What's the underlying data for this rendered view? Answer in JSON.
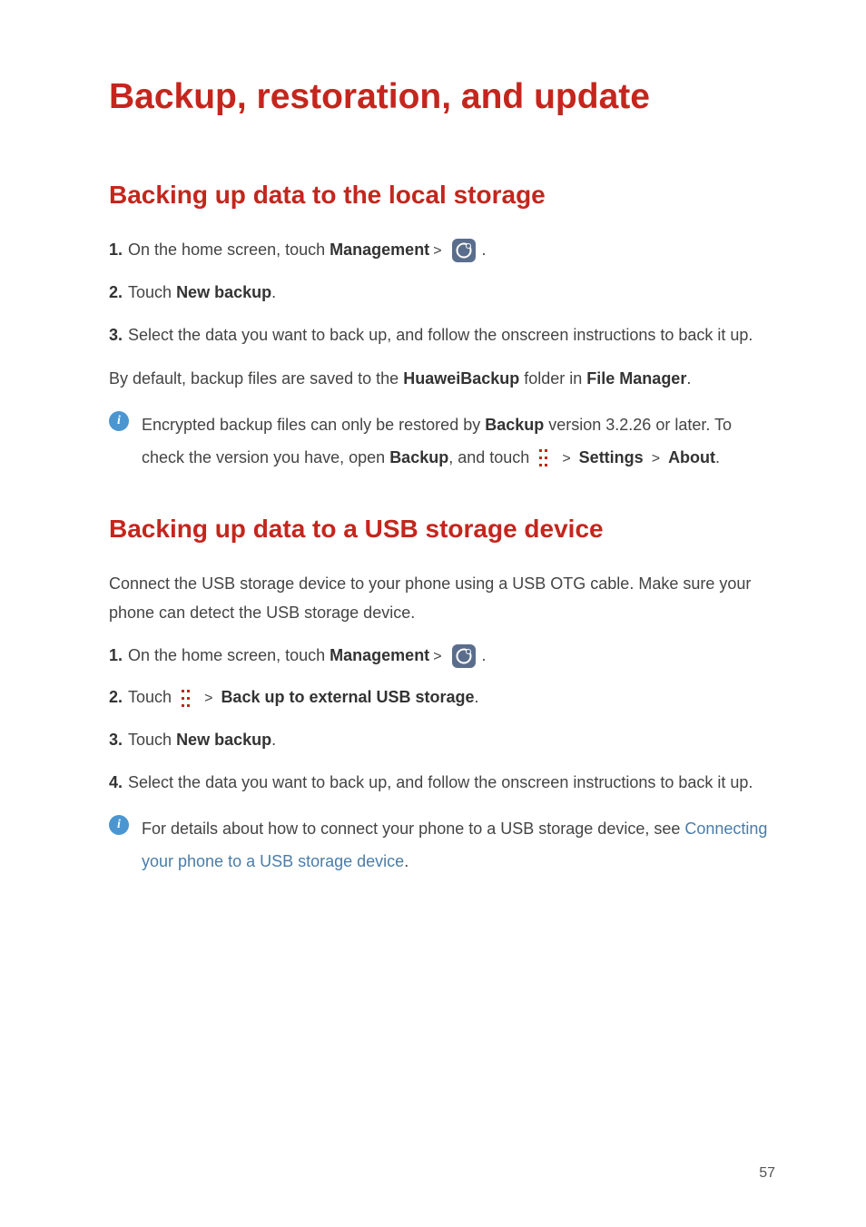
{
  "title": "Backup, restoration, and update",
  "section1": {
    "heading": "Backing up data to the local storage",
    "step1_prefix": "On the home screen, touch ",
    "step1_bold": "Management",
    "step2_prefix": "Touch ",
    "step2_bold": "New backup",
    "step3": "Select the data you want to back up, and follow the onscreen instructions to back it up.",
    "body_prefix": "By default, backup files are saved to the ",
    "body_bold1": "HuaweiBackup",
    "body_mid": " folder in ",
    "body_bold2": "File Manager",
    "info_prefix": "Encrypted backup files can only be restored by ",
    "info_bold1": "Backup",
    "info_mid1": " version 3.2.26 or later. To check the version you have, open ",
    "info_bold2": "Backup",
    "info_mid2": ", and touch ",
    "info_bold3": "Settings",
    "info_bold4": "About"
  },
  "section2": {
    "heading": "Backing up data to a USB storage device",
    "intro": "Connect the USB storage device to your phone using a USB OTG cable. Make sure your phone can detect the USB storage device.",
    "step1_prefix": "On the home screen, touch ",
    "step1_bold": "Management",
    "step2_prefix": "Touch ",
    "step2_bold": "Back up to external USB storage",
    "step3_prefix": "Touch ",
    "step3_bold": "New backup",
    "step4": "Select the data you want to back up, and follow the onscreen instructions to back it up.",
    "info_prefix": "For details about how to connect your phone to a USB storage device, see ",
    "info_link": "Connecting your phone to a USB storage device"
  },
  "numbers": {
    "n1": "1.",
    "n2": "2.",
    "n3": "3.",
    "n4": "4."
  },
  "page": "57",
  "info_glyph": "i"
}
